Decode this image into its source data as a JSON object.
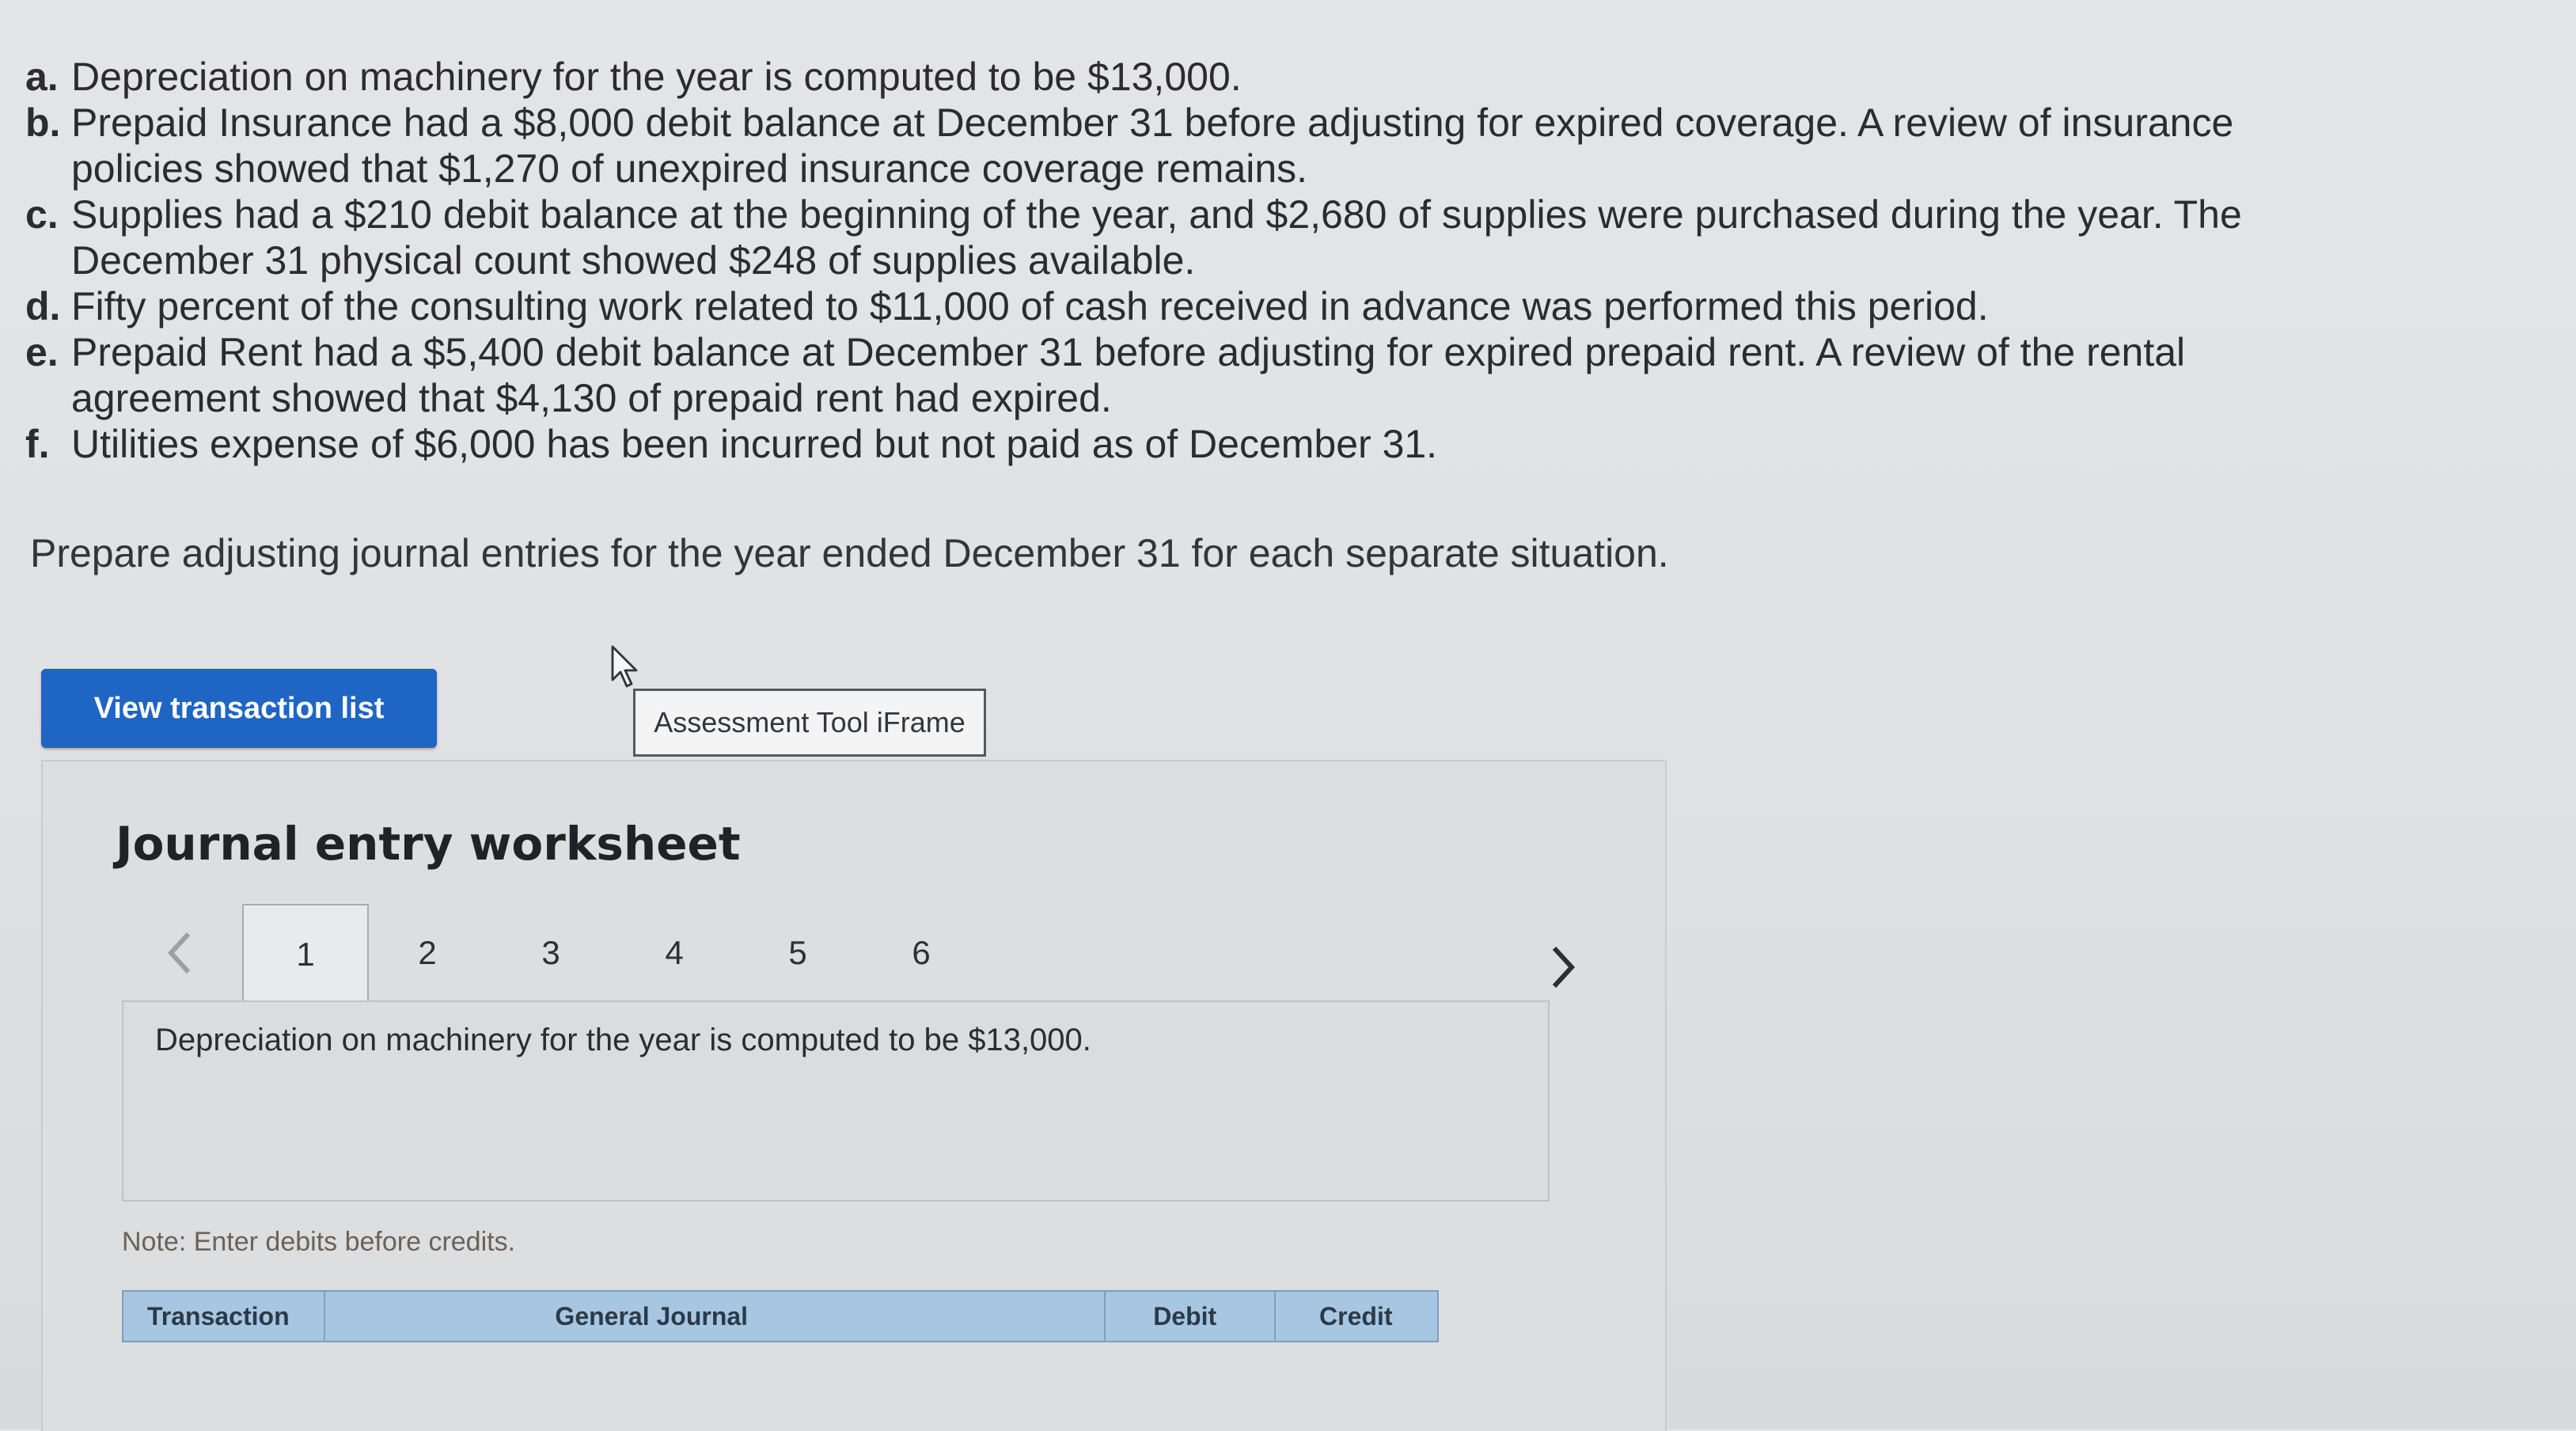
{
  "items": [
    {
      "letter": "a.",
      "text": "Depreciation on machinery for the year is computed to be $13,000."
    },
    {
      "letter": "b.",
      "text": "Prepaid Insurance had a $8,000 debit balance at December 31 before adjusting for expired coverage. A review of insurance policies showed that $1,270 of unexpired insurance coverage remains."
    },
    {
      "letter": "c.",
      "text": "Supplies had a $210 debit balance at the beginning of the year, and $2,680 of supplies were purchased during the year. The December 31 physical count showed $248 of supplies available."
    },
    {
      "letter": "d.",
      "text": "Fifty percent of the consulting work related to $11,000 of cash received in advance was performed this period."
    },
    {
      "letter": "e.",
      "text": "Prepaid Rent had a $5,400 debit balance at December 31 before adjusting for expired prepaid rent. A review of the rental agreement showed that $4,130 of prepaid rent had expired."
    },
    {
      "letter": "f.",
      "text": "Utilities expense of $6,000 has been incurred but not paid as of December 31."
    }
  ],
  "prompt": "Prepare adjusting journal entries for the year ended December 31 for each separate situation.",
  "view_button": "View transaction list",
  "iframe_label": "Assessment Tool iFrame",
  "worksheet": {
    "title": "Journal entry worksheet",
    "tabs": [
      "1",
      "2",
      "3",
      "4",
      "5",
      "6"
    ],
    "active_tab": "1",
    "description": "Depreciation on machinery for the year is computed to be $13,000.",
    "note": "Note: Enter debits before credits.",
    "columns": [
      "Transaction",
      "General Journal",
      "Debit",
      "Credit"
    ]
  },
  "colors": {
    "button_blue": "#1f66c4",
    "table_header": "#a6c6e2",
    "note_text": "#6b6258"
  },
  "icons": [
    "cursor-arrow-icon",
    "chevron-left-icon",
    "chevron-right-icon"
  ]
}
